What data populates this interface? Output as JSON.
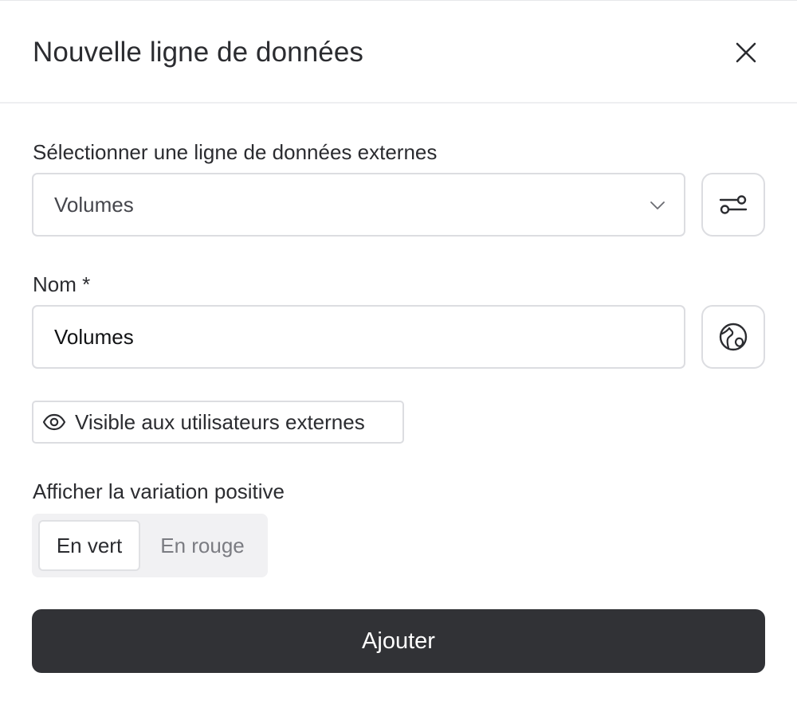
{
  "modal": {
    "title": "Nouvelle ligne de données"
  },
  "external_line": {
    "label": "Sélectionner une ligne de données externes",
    "selected_value": "Volumes"
  },
  "name_field": {
    "label": "Nom *",
    "value": "Volumes"
  },
  "visibility": {
    "label": "Visible aux utilisateurs externes"
  },
  "positive_variation": {
    "label": "Afficher la variation positive",
    "options": [
      "En vert",
      "En rouge"
    ],
    "selected": "En vert"
  },
  "submit": {
    "label": "Ajouter"
  },
  "icons": {
    "close": "close-icon",
    "chevron": "chevron-down-icon",
    "settings": "sliders-icon",
    "translate": "globe-icon",
    "eye": "eye-icon"
  },
  "colors": {
    "primary_button": "#313236",
    "border": "#dcdde1",
    "text": "#2b2c30",
    "muted_text": "#7b7c82",
    "segmented_bg": "#f1f1f3"
  }
}
